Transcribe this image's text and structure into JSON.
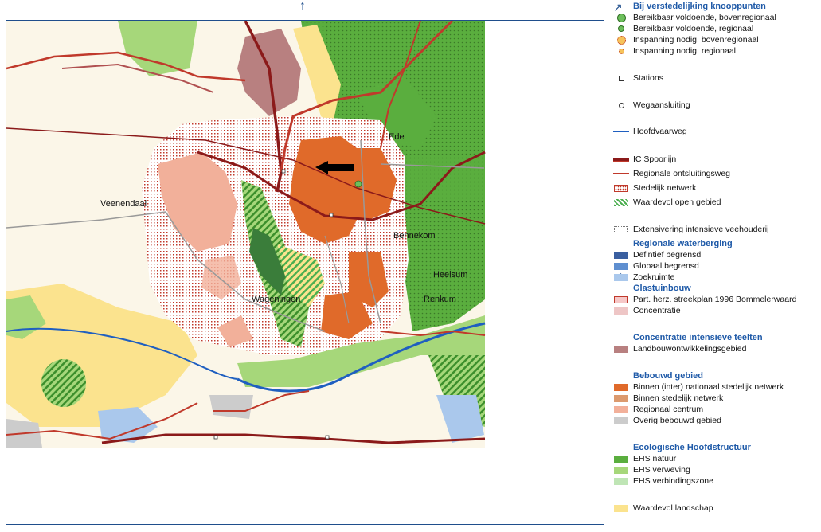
{
  "map": {
    "places": {
      "ede": "Ede",
      "veenendaal": "Veenendaal",
      "bennekom": "Bennekom",
      "heelsum": "Heelsum",
      "wageningen": "Wageningen",
      "renkum": "Renkum"
    },
    "north_arrow_icon": "↑",
    "east_arrow_icon": "→"
  },
  "legend": {
    "section_arrow_icon": "↗",
    "knooppunten": {
      "title": "Bij verstedelijking knooppunten",
      "items": [
        "Bereikbaar voldoende, bovenregionaal",
        "Bereikbaar voldoende, regionaal",
        "Inspanning nodig, bovenregionaal",
        "Inspanning nodig, regionaal"
      ]
    },
    "infra": {
      "stations": "Stations",
      "wegaansluiting": "Wegaansluiting",
      "hoofdvaarweg": "Hoofdvaarweg",
      "ic_spoorlijn": "IC Spoorlijn",
      "regionale_weg": "Regionale ontsluitingsweg",
      "stedelijk_netwerk": "Stedelijk netwerk",
      "waardevol_open": "Waardevol open gebied",
      "extensivering": "Extensivering intensieve veehouderij"
    },
    "waterberging": {
      "title": "Regionale waterberging",
      "items": [
        "Defintief begrensd",
        "Globaal begrensd",
        "Zoekruimte"
      ]
    },
    "glastuinbouw": {
      "title": "Glastuinbouw",
      "items": [
        "Part. herz. streekplan 1996 Bommelerwaard",
        "Concentratie"
      ]
    },
    "teelten": {
      "title": "Concentratie intensieve teelten",
      "items": [
        "Landbouwontwikkelingsgebied"
      ]
    },
    "bebouwd": {
      "title": "Bebouwd gebied",
      "items": [
        "Binnen (inter) nationaal stedelijk netwerk",
        "Binnen stedelijk netwerk",
        "Regionaal centrum",
        "Overig bebouwd gebied"
      ]
    },
    "ehs": {
      "title": "Ecologische Hoofdstructuur",
      "items": [
        "EHS natuur",
        "EHS verweving",
        "EHS verbindingszone"
      ]
    },
    "landschap": "Waardevol landschap"
  },
  "colors": {
    "frame": "#1f4e8c",
    "legend_heading": "#1f5aa8",
    "ehs_natuur": "#5aae3e",
    "ehs_verweving": "#a6d77a",
    "ehs_verbindingszone": "#bfe5b5",
    "waardevol_landschap": "#fbe38e",
    "bebouwd_nationaal": "#e06a2a",
    "bebouwd_stedelijk": "#dc9a6e",
    "regionaal_centrum": "#f2b09a",
    "overig_bebouwd": "#cccccc",
    "landbouwontwikkeling": "#b88080",
    "glas_bommelerwaard": "#f6c8c8",
    "glas_concentratie": "#eec6c6",
    "water_definitief": "#3a5fa0",
    "water_globaal": "#5f8fd0",
    "water_zoekruimte": "#aac8ec",
    "spoorlijn": "#8b1a1a",
    "weg": "#c0392b",
    "vaarweg": "#1f5fc0"
  }
}
